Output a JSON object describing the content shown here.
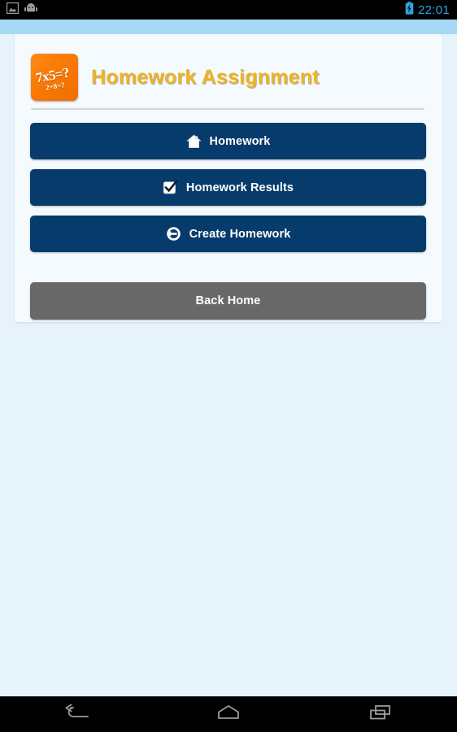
{
  "statusbar": {
    "time": "22:01",
    "left_icons": [
      {
        "name": "screenshot-icon"
      },
      {
        "name": "android-robot-icon"
      }
    ],
    "battery_icon": "battery-charging-icon",
    "accent_color": "#2ea3dd",
    "background_color": "#000000"
  },
  "theme": {
    "page_background": "#e7f3fb",
    "top_band": "#a6d8f4",
    "card_background": "#f4fafd",
    "primary_button": "#073b6c",
    "secondary_button": "#686868",
    "title_color": "#f0b322",
    "logo_color": "#f97805"
  },
  "card": {
    "logo": {
      "name": "homework-logo",
      "line1": "7x5=?",
      "line2": "2+8=?"
    },
    "title": "Homework Assignment"
  },
  "buttons": [
    {
      "id": "homework",
      "label": "Homework",
      "icon": "home-icon",
      "style": "primary"
    },
    {
      "id": "homework-results",
      "label": "Homework Results",
      "icon": "checkbox-checked-icon",
      "style": "primary"
    },
    {
      "id": "create-homework",
      "label": "Create Homework",
      "icon": "enter-arrow-circle-icon",
      "style": "primary"
    }
  ],
  "back_button": {
    "label": "Back Home",
    "style": "secondary"
  },
  "navbar": {
    "back": "back-nav-icon",
    "home": "home-nav-icon",
    "recents": "recents-nav-icon"
  }
}
